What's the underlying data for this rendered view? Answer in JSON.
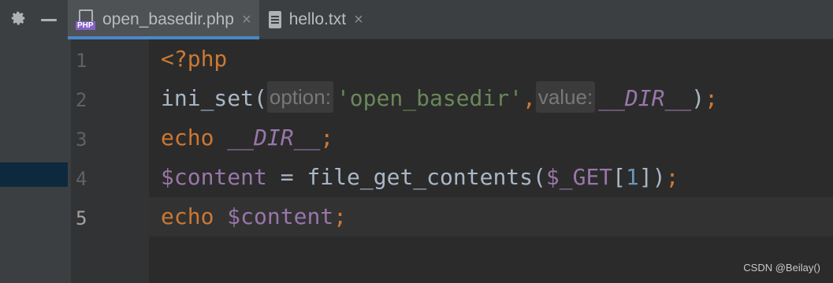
{
  "toolbar": {
    "settings_icon": "gear-icon",
    "hide_icon": "minus-icon"
  },
  "tabs": [
    {
      "label": "open_basedir.php",
      "icon": "php-file-icon",
      "active": true,
      "close": "×"
    },
    {
      "label": "hello.txt",
      "icon": "text-file-icon",
      "active": false,
      "close": "×"
    }
  ],
  "gutter": {
    "line_numbers": [
      "1",
      "2",
      "3",
      "4",
      "5"
    ],
    "current_line": "5"
  },
  "code": {
    "line1": {
      "open_tag": "<?php"
    },
    "line2": {
      "func": "ini_set",
      "paren_open": "(",
      "hint_option": "option:",
      "arg1": "'open_basedir'",
      "comma": ",",
      "hint_value": "value:",
      "arg2": "__DIR__",
      "paren_close": ")",
      "semi": ";"
    },
    "line3": {
      "keyword": "echo",
      "space": " ",
      "const": "__DIR__",
      "semi": ";"
    },
    "line4": {
      "var": "$content",
      "assign": " = ",
      "func": "file_get_contents",
      "paren_open": "(",
      "superglobal": "$_GET",
      "bracket_open": "[",
      "index": "1",
      "bracket_close": "]",
      "paren_close": ")",
      "semi": ";"
    },
    "line5": {
      "keyword": "echo",
      "space": " ",
      "var": "$content",
      "semi": ";"
    }
  },
  "watermark": "CSDN @Beilay()",
  "colors": {
    "keyword": "#cc7832",
    "string": "#6a8759",
    "variable": "#9876aa",
    "number": "#6897bb",
    "text": "#a9b7c6",
    "background": "#2b2b2b"
  }
}
